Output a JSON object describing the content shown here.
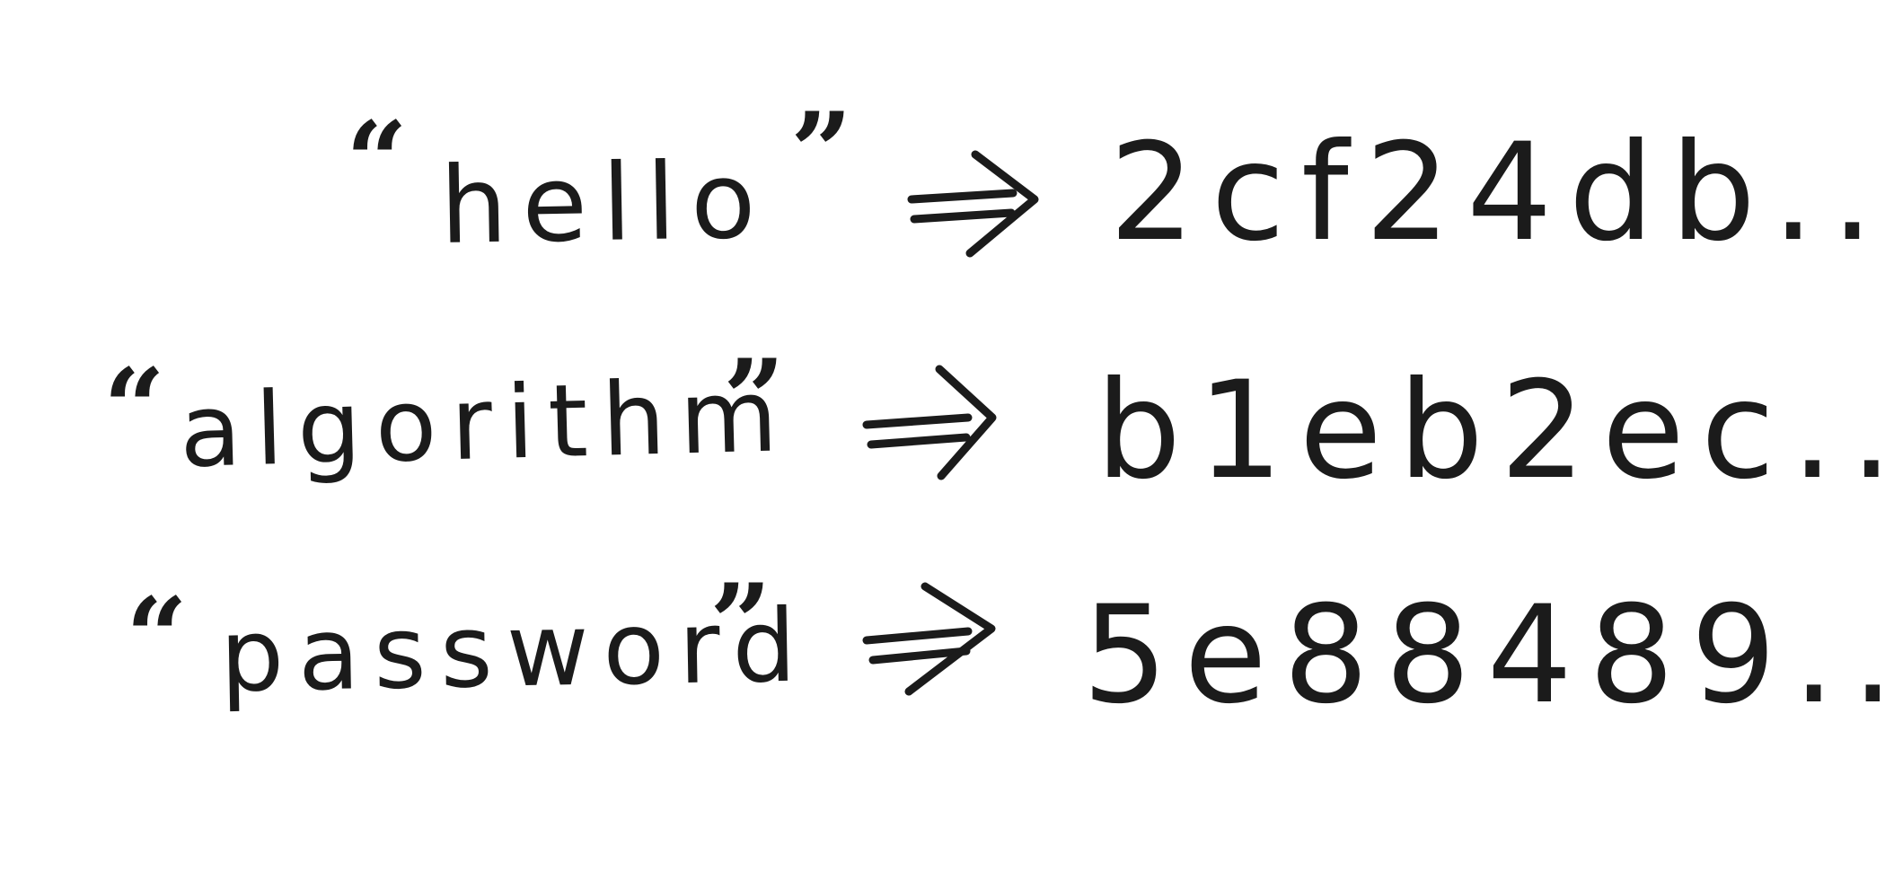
{
  "symbols": {
    "open_quote": "“",
    "close_quote": "”",
    "arrow": "double-arrow"
  },
  "rows": [
    {
      "input": "hello",
      "hash": "2cf24db..."
    },
    {
      "input": "algorithm",
      "hash": "b1eb2ec..."
    },
    {
      "input": "password",
      "hash": "5e88489..."
    }
  ]
}
